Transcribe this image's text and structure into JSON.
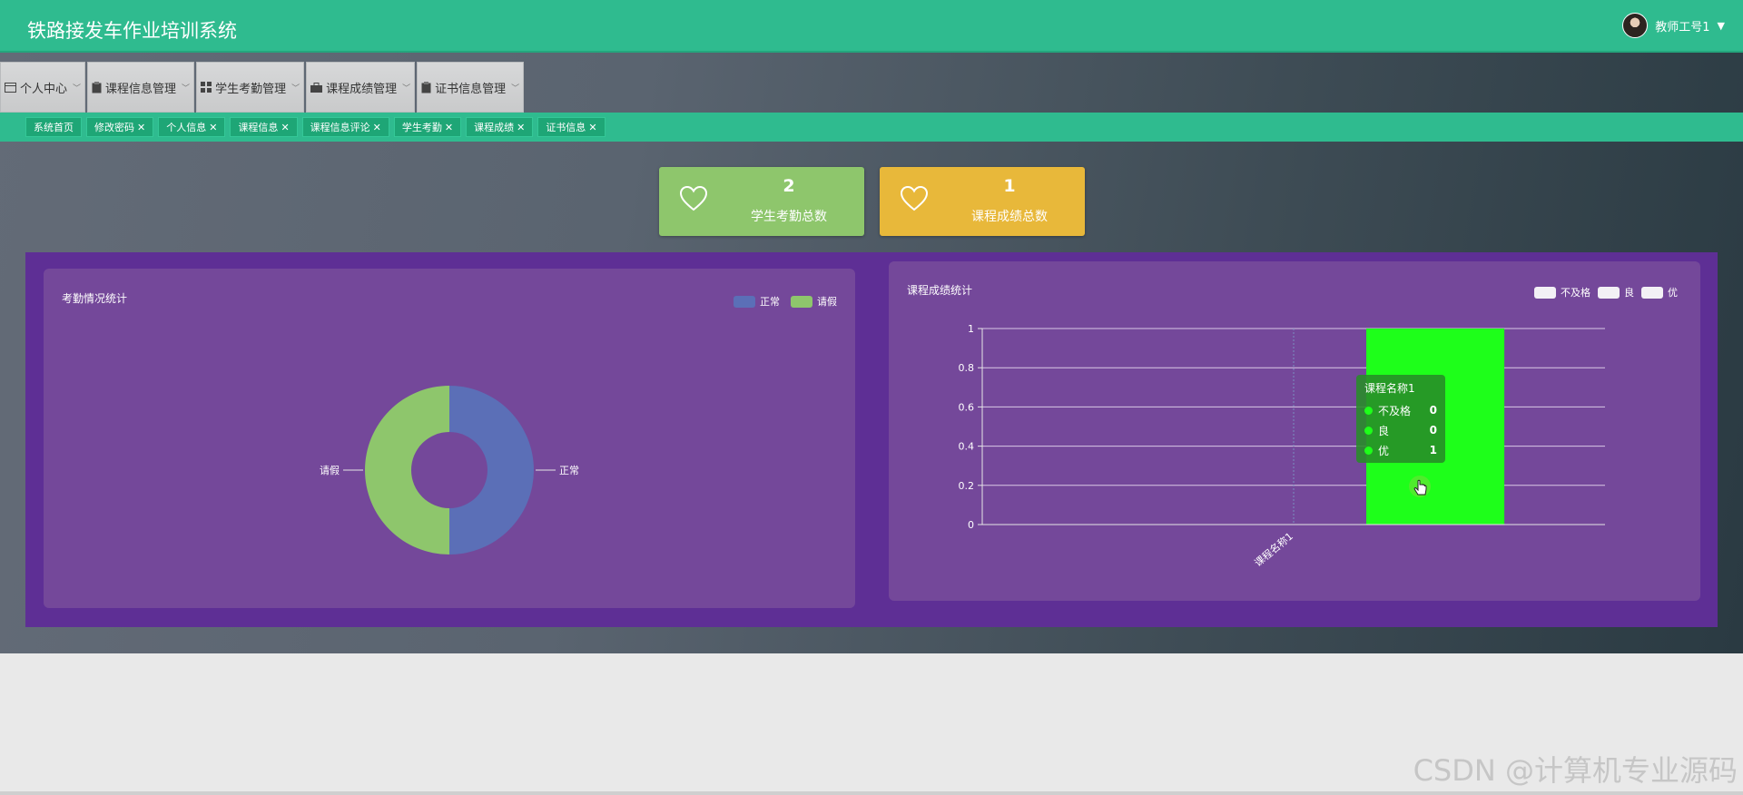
{
  "app": {
    "title": "铁路接发车作业培训系统"
  },
  "user": {
    "name": "教师工号1"
  },
  "menu": [
    {
      "label": "个人中心",
      "icon": "calendar-icon"
    },
    {
      "label": "课程信息管理",
      "icon": "clipboard-icon"
    },
    {
      "label": "学生考勤管理",
      "icon": "grid-icon"
    },
    {
      "label": "课程成绩管理",
      "icon": "briefcase-icon"
    },
    {
      "label": "证书信息管理",
      "icon": "clipboard-icon"
    }
  ],
  "tabs": [
    {
      "label": "系统首页",
      "closable": false
    },
    {
      "label": "修改密码",
      "closable": true
    },
    {
      "label": "个人信息",
      "closable": true
    },
    {
      "label": "课程信息",
      "closable": true
    },
    {
      "label": "课程信息评论",
      "closable": true
    },
    {
      "label": "学生考勤",
      "closable": true
    },
    {
      "label": "课程成绩",
      "closable": true
    },
    {
      "label": "证书信息",
      "closable": true
    }
  ],
  "tab_close_glyph": "✕",
  "stats": [
    {
      "value": "2",
      "label": "学生考勤总数",
      "color": "#8ec66c",
      "icon": "heart-icon"
    },
    {
      "value": "1",
      "label": "课程成绩总数",
      "color": "#e8b83a",
      "icon": "heart-icon"
    }
  ],
  "chart_data": [
    {
      "type": "pie",
      "title": "考勤情况统计",
      "legend_position": "top-right",
      "series": [
        {
          "name": "正常",
          "value": 1,
          "color": "#5b6fb7"
        },
        {
          "name": "请假",
          "value": 1,
          "color": "#8ec66c"
        }
      ]
    },
    {
      "type": "bar",
      "title": "课程成绩统计",
      "legend_position": "top-right",
      "categories": [
        "课程名称1"
      ],
      "series": [
        {
          "name": "不及格",
          "values": [
            0
          ],
          "color": "#f2f0f5"
        },
        {
          "name": "良",
          "values": [
            0
          ],
          "color": "#f2f0f5"
        },
        {
          "name": "优",
          "values": [
            1
          ],
          "color": "#1eff1a"
        }
      ],
      "ylim": [
        0,
        1
      ],
      "yticks": [
        "0",
        "0.2",
        "0.4",
        "0.6",
        "0.8",
        "1"
      ],
      "grid": true
    }
  ],
  "tooltip": {
    "title": "课程名称1",
    "rows": [
      {
        "name": "不及格",
        "value": "0"
      },
      {
        "name": "良",
        "value": "0"
      },
      {
        "name": "优",
        "value": "1"
      }
    ]
  },
  "watermark": "CSDN @计算机专业源码"
}
